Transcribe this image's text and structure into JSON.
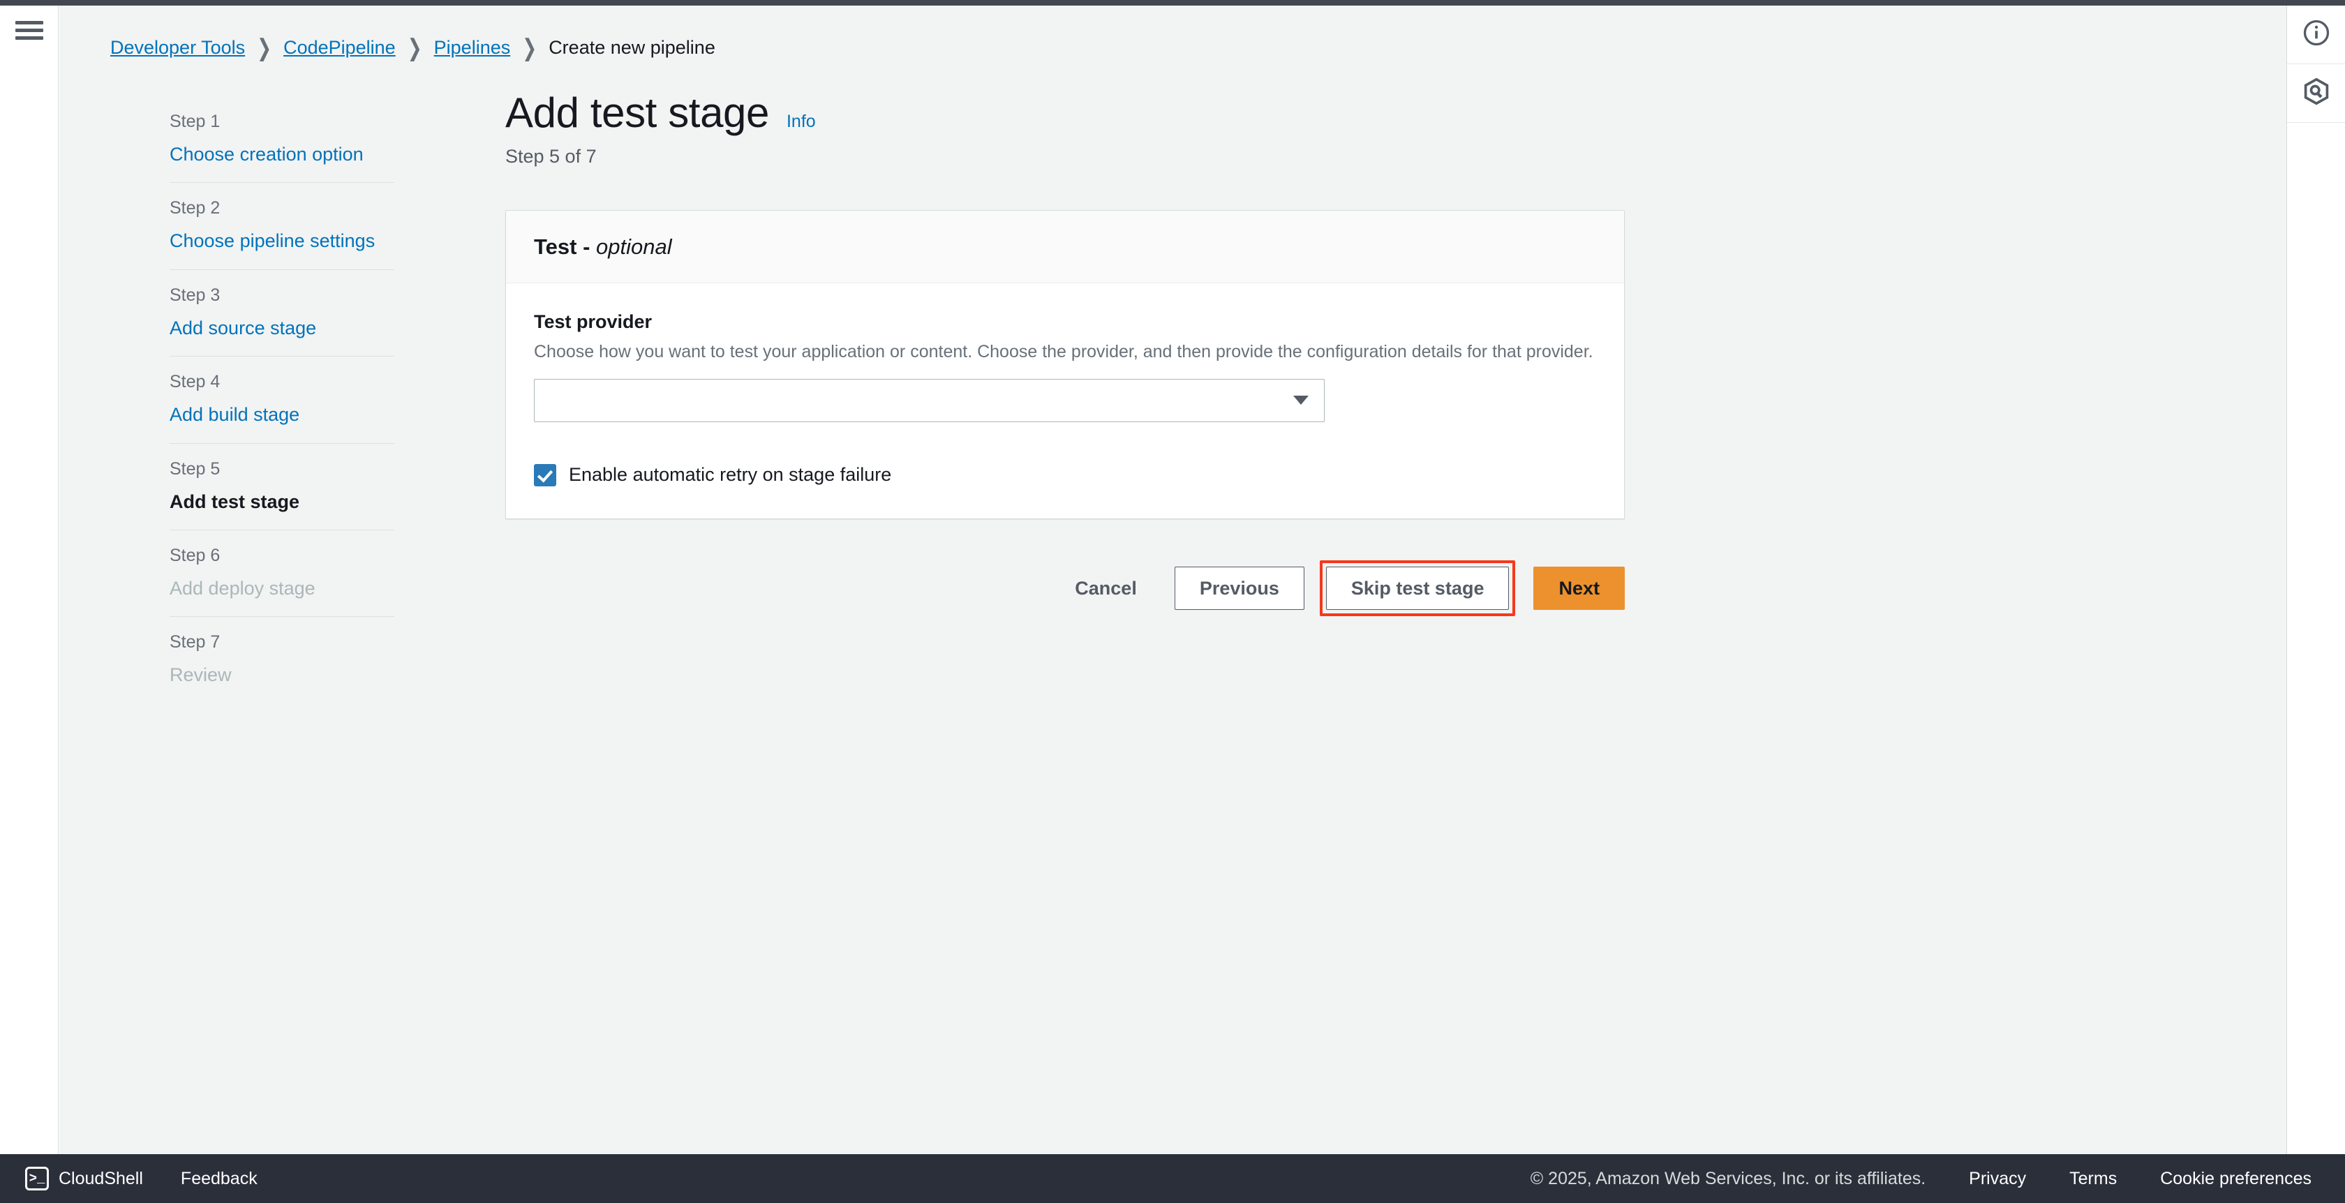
{
  "breadcrumb": {
    "items": [
      {
        "label": "Developer Tools",
        "link": true
      },
      {
        "label": "CodePipeline",
        "link": true
      },
      {
        "label": "Pipelines",
        "link": true
      },
      {
        "label": "Create new pipeline",
        "link": false
      }
    ],
    "separator": "❯"
  },
  "left_rail": {
    "menu_icon": "hamburger-menu-icon"
  },
  "right_rail": {
    "info_icon": "info-circle-icon",
    "q_icon": "amazon-q-hexagon-icon"
  },
  "sidebar": {
    "steps": [
      {
        "number": "Step 1",
        "label": "Choose creation option",
        "state": "link"
      },
      {
        "number": "Step 2",
        "label": "Choose pipeline settings",
        "state": "link"
      },
      {
        "number": "Step 3",
        "label": "Add source stage",
        "state": "link"
      },
      {
        "number": "Step 4",
        "label": "Add build stage",
        "state": "link"
      },
      {
        "number": "Step 5",
        "label": "Add test stage",
        "state": "active"
      },
      {
        "number": "Step 6",
        "label": "Add deploy stage",
        "state": "disabled"
      },
      {
        "number": "Step 7",
        "label": "Review",
        "state": "disabled"
      }
    ]
  },
  "page": {
    "title": "Add test stage",
    "info_label": "Info",
    "subtitle": "Step 5 of 7"
  },
  "card": {
    "header_title": "Test",
    "header_optional": "optional",
    "header_dash": "-",
    "field_label": "Test provider",
    "field_description": "Choose how you want to test your application or content. Choose the provider, and then provide the configuration details for that provider.",
    "select_value": "",
    "select_placeholder": "",
    "checkbox_label": "Enable automatic retry on stage failure",
    "checkbox_checked": true
  },
  "actions": {
    "cancel": "Cancel",
    "previous": "Previous",
    "skip": "Skip test stage",
    "next": "Next",
    "highlight_color": "#f5391b",
    "primary_color": "#ec912d"
  },
  "footer": {
    "cloudshell": "CloudShell",
    "cloudshell_glyph": ">_",
    "feedback": "Feedback",
    "copyright": "© 2025, Amazon Web Services, Inc. or its affiliates.",
    "privacy": "Privacy",
    "terms": "Terms",
    "cookie_preferences": "Cookie preferences"
  }
}
